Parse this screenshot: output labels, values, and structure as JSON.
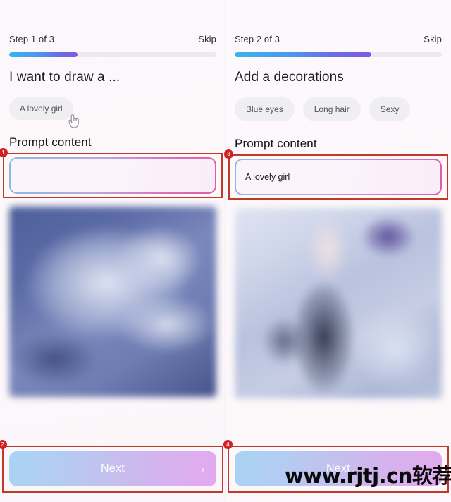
{
  "watermark": {
    "text": "www.rjtj.cn软荐网"
  },
  "panels": [
    {
      "step_label": "Step 1 of 3",
      "skip_label": "Skip",
      "progress_percent": 33,
      "heading": "I want to draw a ...",
      "chips": [
        {
          "label": "A lovely girl"
        }
      ],
      "cursor_icon": "pointing-hand-icon",
      "prompt_label": "Prompt content",
      "prompt_value": "",
      "prompt_placeholder": "",
      "preview_alt": "blurred-generated-artwork-preview",
      "next_label": "Next",
      "chevron_icon": "chevron-right-icon",
      "annotations": [
        {
          "id": "1",
          "target": "prompt-input"
        },
        {
          "id": "2",
          "target": "next-button"
        }
      ]
    },
    {
      "step_label": "Step 2 of 3",
      "skip_label": "Skip",
      "progress_percent": 66,
      "heading": "Add a decorations",
      "chips": [
        {
          "label": "Blue eyes"
        },
        {
          "label": "Long hair"
        },
        {
          "label": "Sexy"
        }
      ],
      "prompt_label": "Prompt content",
      "prompt_value": "A lovely girl",
      "prompt_placeholder": "",
      "preview_alt": "blurred-generated-artwork-preview",
      "next_label": "Next",
      "chevron_icon": "chevron-right-icon",
      "annotations": [
        {
          "id": "3",
          "target": "prompt-input"
        },
        {
          "id": "4",
          "target": "next-button"
        }
      ]
    }
  ],
  "colors": {
    "progress_start": "#34b6ef",
    "progress_end": "#7a5ce2",
    "annotation_red": "#c0392b",
    "badge_red": "#cf2222",
    "chip_bg": "#efeef1",
    "button_gradient_start": "#a9d4f3",
    "button_gradient_end": "#e3a9ef"
  }
}
